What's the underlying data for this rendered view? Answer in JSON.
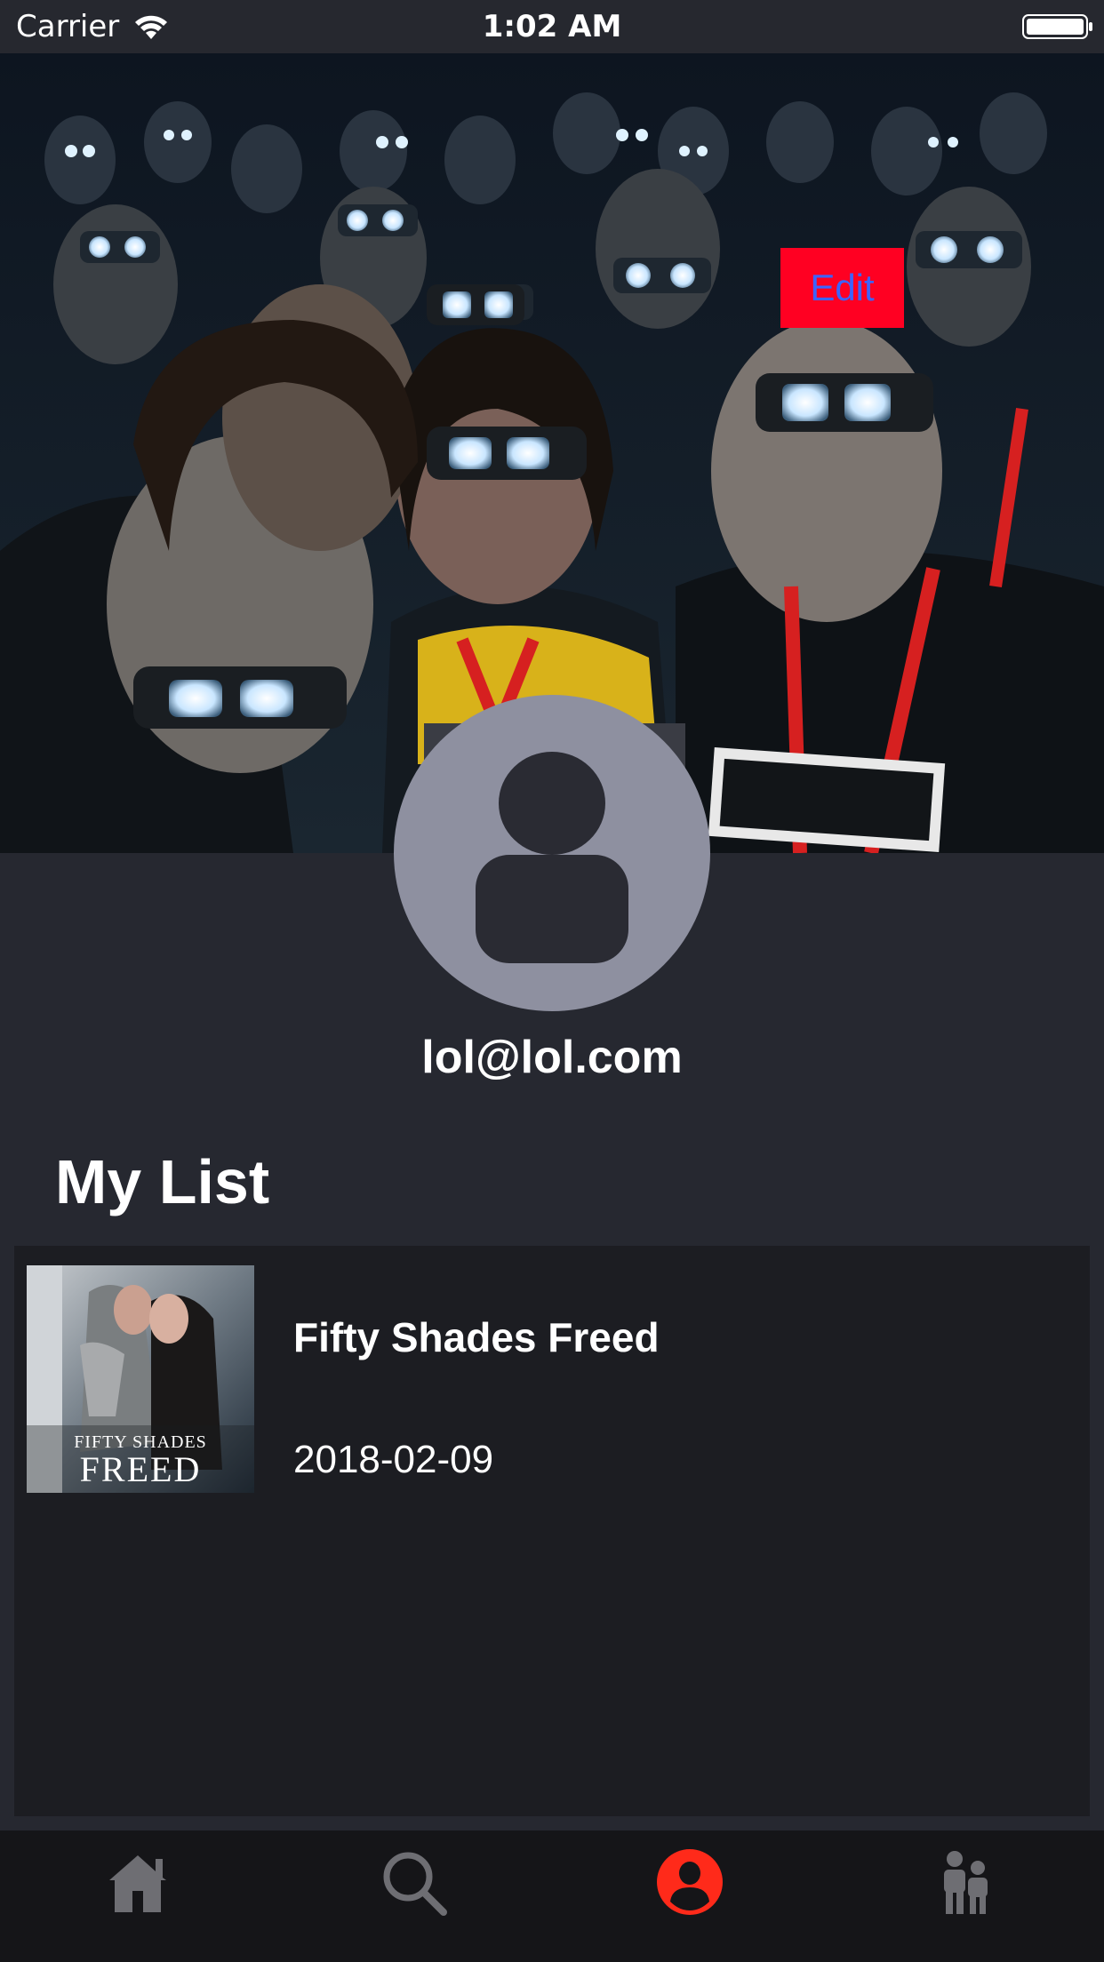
{
  "status_bar": {
    "carrier": "Carrier",
    "time": "1:02 AM"
  },
  "header": {
    "edit_label": "Edit"
  },
  "profile": {
    "email": "lol@lol.com"
  },
  "my_list": {
    "title": "My List",
    "items": [
      {
        "title": "Fifty Shades Freed",
        "release_date": "2018-02-09",
        "poster_caption_line1": "FIFTY SHADES",
        "poster_caption_line2": "FREED"
      }
    ]
  },
  "tab_bar": {
    "tabs": [
      {
        "icon": "home-icon",
        "active": false
      },
      {
        "icon": "search-icon",
        "active": false
      },
      {
        "icon": "profile-icon",
        "active": true
      },
      {
        "icon": "people-icon",
        "active": false
      }
    ]
  },
  "colors": {
    "accent": "#ff2a1a",
    "edit_button_bg": "#ff0022",
    "edit_button_text": "#3b64ff",
    "avatar_bg": "#8e90a0",
    "page_bg": "#262830",
    "list_bg": "#1c1d22",
    "tab_inactive": "#6e6e73"
  }
}
